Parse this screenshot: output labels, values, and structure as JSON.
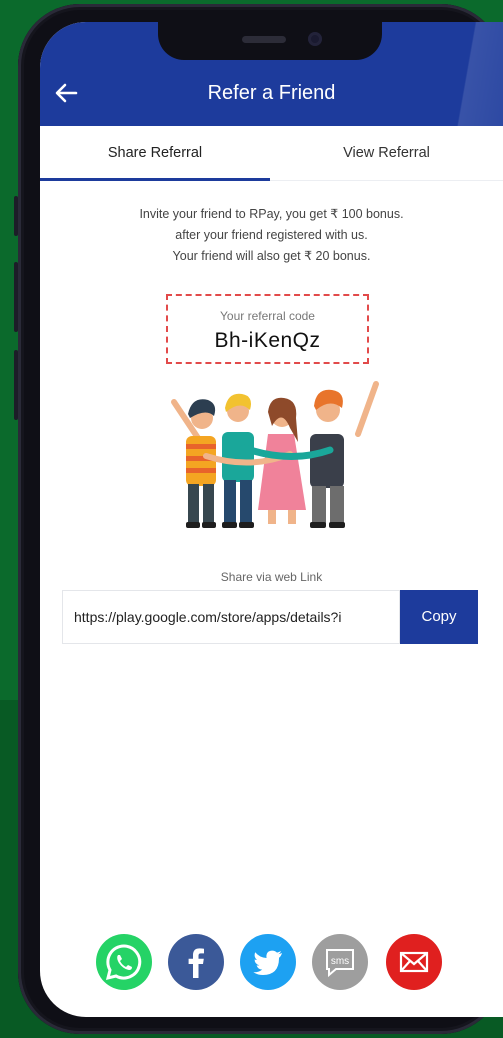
{
  "header": {
    "title": "Refer a Friend",
    "back_icon": "arrow-left-icon"
  },
  "tabs": [
    {
      "label": "Share Referral",
      "active": true
    },
    {
      "label": "View Referral",
      "active": false
    }
  ],
  "invite": {
    "line1": "Invite your friend to RPay, you get ₹ 100 bonus.",
    "line2": "after your friend registered with us.",
    "line3": "Your friend will also get ₹ 20 bonus."
  },
  "referral": {
    "label": "Your referral code",
    "code": "Bh-iKenQz"
  },
  "share": {
    "label": "Share via web Link",
    "link": "https://play.google.com/store/apps/details?i",
    "copy_label": "Copy"
  },
  "social_icons": [
    {
      "name": "whatsapp-icon",
      "color": "#25d366"
    },
    {
      "name": "facebook-icon",
      "color": "#3b5998"
    },
    {
      "name": "twitter-icon",
      "color": "#1da1f2"
    },
    {
      "name": "sms-icon",
      "color": "#9e9e9e",
      "text": "sms"
    },
    {
      "name": "email-icon",
      "color": "#e0201f"
    }
  ],
  "colors": {
    "primary": "#1d3b9c",
    "background": "#0b6a2c",
    "code_border": "#e24a4a"
  }
}
